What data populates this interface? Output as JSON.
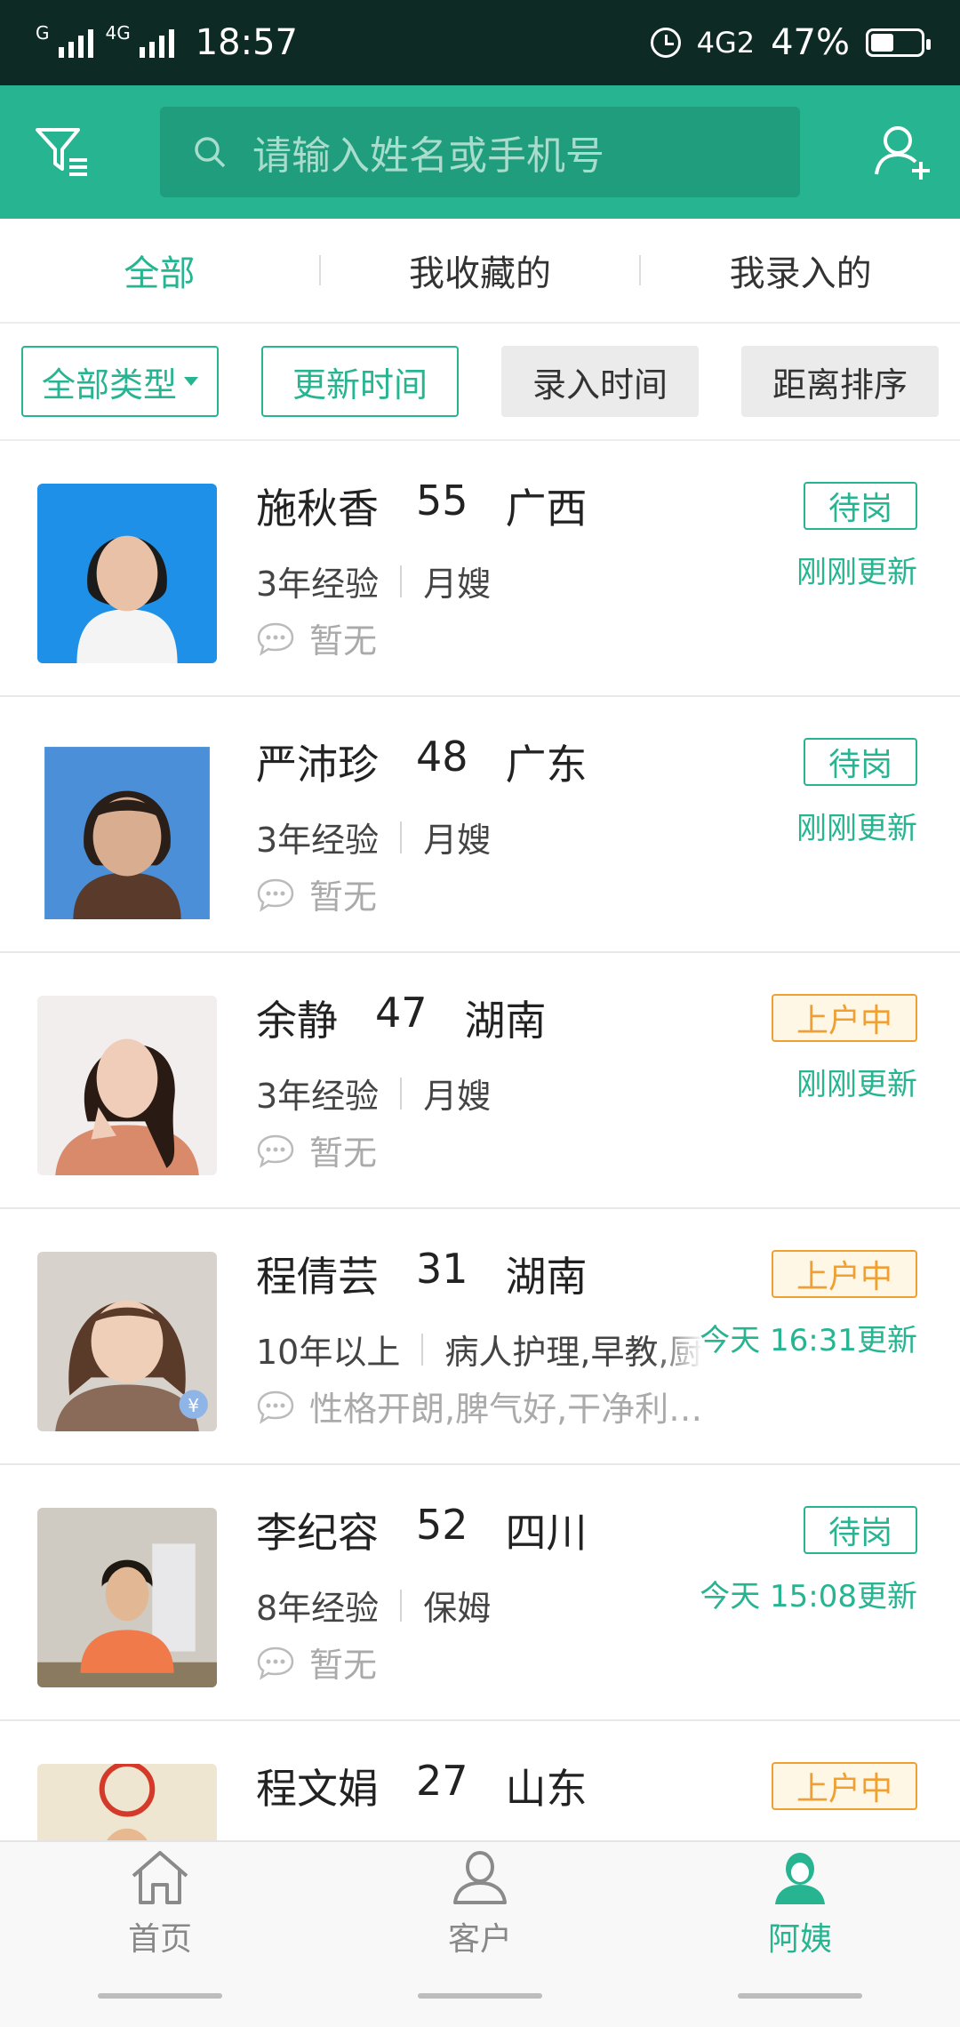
{
  "status_bar": {
    "time": "18:57",
    "network": "4G",
    "network2": "4G2",
    "signal_tag": "G",
    "battery": "47%",
    "battery_level": 0.47
  },
  "header": {
    "search_placeholder": "请输入姓名或手机号"
  },
  "tabs": [
    {
      "label": "全部",
      "active": true
    },
    {
      "label": "我收藏的",
      "active": false
    },
    {
      "label": "我录入的",
      "active": false
    }
  ],
  "filters": [
    {
      "label": "全部类型",
      "style": "outline"
    },
    {
      "label": "更新时间",
      "style": "outline"
    },
    {
      "label": "录入时间",
      "style": "gray"
    },
    {
      "label": "距离排序",
      "style": "gray"
    }
  ],
  "workers": [
    {
      "name": "施秋香",
      "age": "55",
      "province": "广西",
      "experience": "3年经验",
      "skills": "月嫂",
      "note": "暂无",
      "status": "待岗",
      "updated": "刚刚更新"
    },
    {
      "name": "严沛珍",
      "age": "48",
      "province": "广东",
      "experience": "3年经验",
      "skills": "月嫂",
      "note": "暂无",
      "status": "待岗",
      "updated": "刚刚更新"
    },
    {
      "name": "余静",
      "age": "47",
      "province": "湖南",
      "experience": "3年经验",
      "skills": "月嫂",
      "note": "暂无",
      "status": "上户中",
      "updated": "刚刚更新"
    },
    {
      "name": "程倩芸",
      "age": "31",
      "province": "湖南",
      "experience": "10年以上",
      "skills": "病人护理,早教,厨",
      "note": "性格开朗,脾气好,干净利…",
      "status": "上户中",
      "updated": "今天 16:31更新"
    },
    {
      "name": "李纪容",
      "age": "52",
      "province": "四川",
      "experience": "8年经验",
      "skills": "保姆",
      "note": "暂无",
      "status": "待岗",
      "updated": "今天 15:08更新"
    },
    {
      "name": "程文娟",
      "age": "27",
      "province": "山东",
      "experience": "",
      "skills": "",
      "note": "",
      "status": "上户中",
      "updated": ""
    }
  ],
  "bottom_nav": [
    {
      "label": "首页",
      "icon": "home-icon",
      "active": false
    },
    {
      "label": "客户",
      "icon": "customer-icon",
      "active": false
    },
    {
      "label": "阿姨",
      "icon": "nanny-icon",
      "active": true
    }
  ],
  "colors": {
    "brand": "#26b491",
    "busy": "#f0a032"
  }
}
